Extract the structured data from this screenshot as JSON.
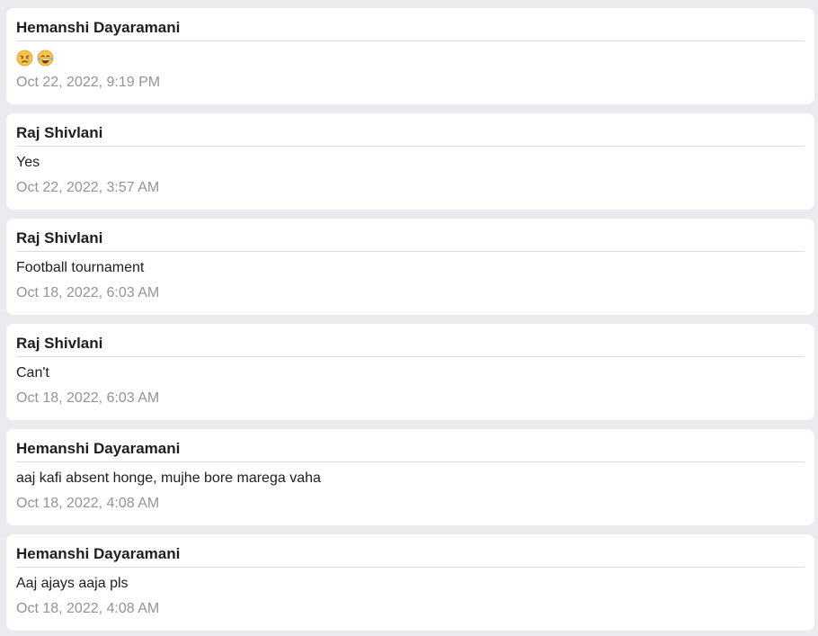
{
  "messages": [
    {
      "sender": "Hemanshi Dayaramani",
      "text": "",
      "emoji": [
        "disappointed-relieved-emoji",
        "tears-of-joy-emoji"
      ],
      "timestamp": "Oct 22, 2022, 9:19 PM"
    },
    {
      "sender": "Raj Shivlani",
      "text": "Yes",
      "timestamp": "Oct 22, 2022, 3:57 AM"
    },
    {
      "sender": "Raj Shivlani",
      "text": "Football tournament",
      "timestamp": "Oct 18, 2022, 6:03 AM"
    },
    {
      "sender": "Raj Shivlani",
      "text": "Can't",
      "timestamp": "Oct 18, 2022, 6:03 AM"
    },
    {
      "sender": "Hemanshi Dayaramani",
      "text": "aaj kafi absent honge, mujhe bore marega vaha",
      "timestamp": "Oct 18, 2022, 4:08 AM"
    },
    {
      "sender": "Hemanshi Dayaramani",
      "text": "Aaj ajays aaja pls",
      "timestamp": "Oct 18, 2022, 4:08 AM"
    }
  ],
  "colors": {
    "page_background": "#e9ebee",
    "card_background": "#ffffff",
    "sender_text": "#1c1e21",
    "timestamp_text": "#90949c",
    "divider": "#dadde1"
  }
}
